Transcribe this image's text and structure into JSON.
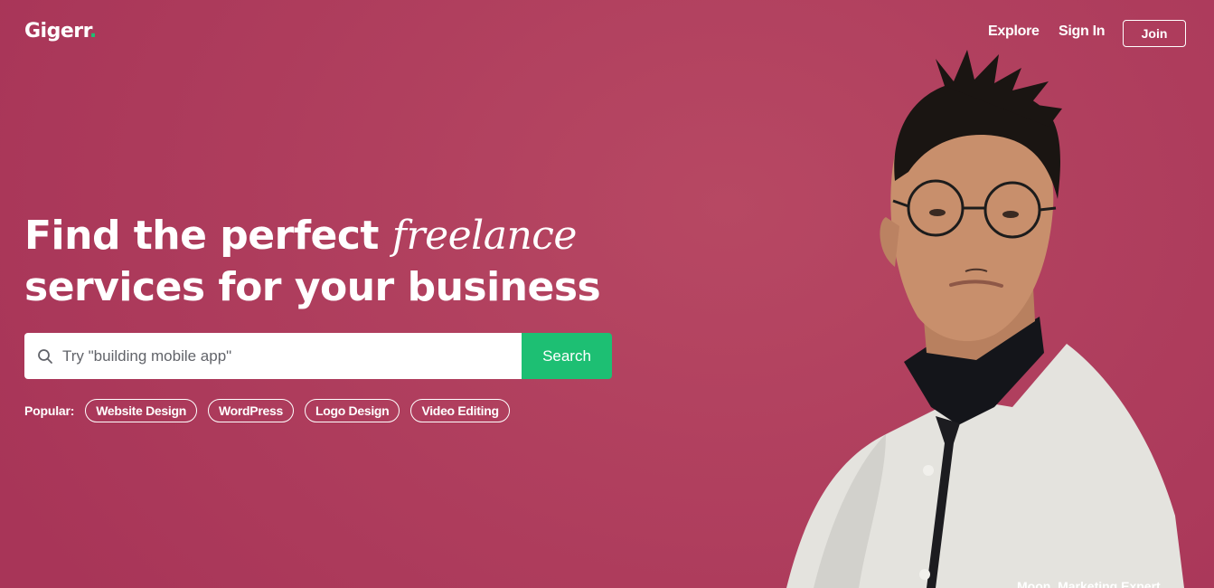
{
  "header": {
    "logo_text": "Gigerr",
    "logo_dot": ".",
    "nav": {
      "explore": "Explore",
      "sign_in": "Sign In",
      "join": "Join"
    }
  },
  "hero": {
    "headline_line1_start": "Find the perfect ",
    "headline_italic": "freelance",
    "headline_line2": "services for your business",
    "search": {
      "placeholder": "Try \"building mobile app\"",
      "value": "",
      "button_label": "Search"
    },
    "popular": {
      "label": "Popular:",
      "tags": [
        "Website Design",
        "WordPress",
        "Logo Design",
        "Video Editing"
      ]
    },
    "caption": "Moon, Marketing Expert"
  },
  "colors": {
    "background": "#b2405e",
    "accent": "#1dbf73",
    "text": "#ffffff"
  }
}
